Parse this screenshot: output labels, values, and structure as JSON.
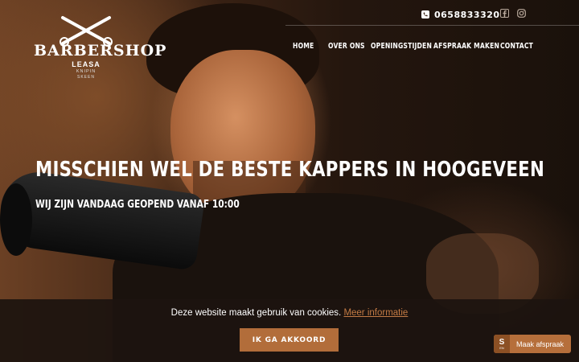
{
  "header": {
    "logo": {
      "title": "BARBERSHOP",
      "sub": "LEASA",
      "sub2": "KNIPIN",
      "sub3": "SKEEN"
    },
    "phone": "0658833320",
    "social": [
      "facebook-icon",
      "instagram-icon"
    ]
  },
  "nav": {
    "items": [
      {
        "label": "HOME"
      },
      {
        "label": "OVER ONS"
      },
      {
        "label": "OPENINGSTIJDEN"
      },
      {
        "label": "AFSPRAAK MAKEN"
      },
      {
        "label": "CONTACT"
      }
    ]
  },
  "hero": {
    "headline": "MISSCHIEN WEL DE BESTE KAPPERS IN HOOGEVEEN",
    "subline": "WIJ ZIJN VANDAAG GEOPEND VANAF 10:00"
  },
  "cookie": {
    "text": "Deze website maakt gebruik van cookies.",
    "more": "Meer informatie",
    "button": "IK GA AKKOORD"
  },
  "booking": {
    "badge_s": "S",
    "badge_en": "EN",
    "label": "Maak afspraak"
  },
  "colors": {
    "accent": "#b26d3a",
    "link": "#c27a44"
  }
}
